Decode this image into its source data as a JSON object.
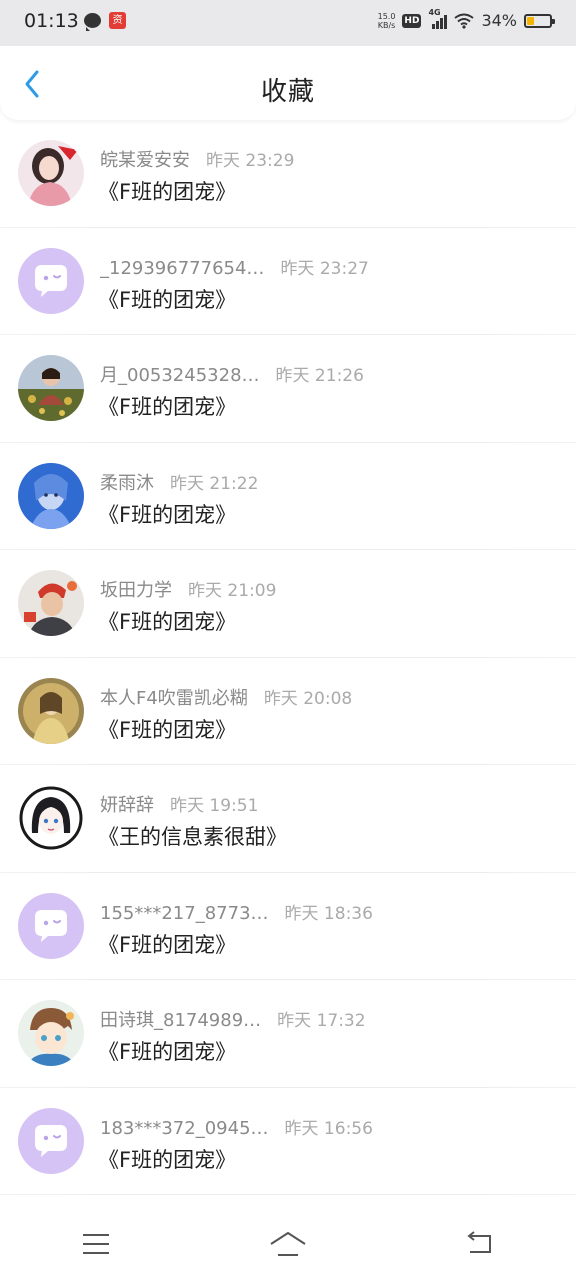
{
  "status_bar": {
    "time": "01:13",
    "badge_text": "资",
    "net_speed_value": "15.0",
    "net_speed_unit": "KB/s",
    "hd_label": "HD",
    "network_label": "4G",
    "battery_percent": "34%",
    "battery_level": 0.34,
    "battery_color": "#f4b400"
  },
  "header": {
    "title": "收藏"
  },
  "items": [
    {
      "username": "皖某爱安安",
      "time": "昨天 23:29",
      "title": "《F班的团宠》",
      "avatar": "photo-girl-pink"
    },
    {
      "username": "_129396777654…",
      "time": "昨天 23:27",
      "title": "《F班的团宠》",
      "avatar": "default-chat-icon"
    },
    {
      "username": "月_0053245328…",
      "time": "昨天 21:26",
      "title": "《F班的团宠》",
      "avatar": "photo-flowers"
    },
    {
      "username": "柔雨沐",
      "time": "昨天 21:22",
      "title": "《F班的团宠》",
      "avatar": "photo-blue-figure"
    },
    {
      "username": "坂田力学",
      "time": "昨天 21:09",
      "title": "《F班的团宠》",
      "avatar": "photo-boy-red"
    },
    {
      "username": "本人F4吹雷凯必糊",
      "time": "昨天 20:08",
      "title": "《F班的团宠》",
      "avatar": "photo-gold-figure"
    },
    {
      "username": "妍辞辞",
      "time": "昨天 19:51",
      "title": "《王的信息素很甜》",
      "avatar": "anime-girl"
    },
    {
      "username": "155***217_8773…",
      "time": "昨天 18:36",
      "title": "《F班的团宠》",
      "avatar": "default-chat-icon"
    },
    {
      "username": "田诗琪_8174989…",
      "time": "昨天 17:32",
      "title": "《F班的团宠》",
      "avatar": "cartoon-boy"
    },
    {
      "username": "183***372_0945…",
      "time": "昨天 16:56",
      "title": "《F班的团宠》",
      "avatar": "default-chat-icon"
    }
  ],
  "colors": {
    "accent_blue": "#2f9be6",
    "default_avatar_bg": "#d6c3f5"
  },
  "nav": {
    "icons": [
      "menu-icon",
      "home-icon",
      "back-icon"
    ]
  }
}
